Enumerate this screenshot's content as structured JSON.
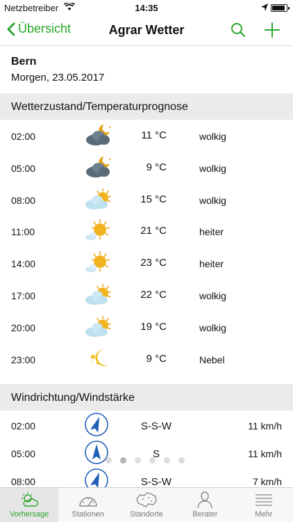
{
  "status": {
    "carrier": "Netzbetreiber",
    "time": "14:35",
    "battery": 0.9
  },
  "nav": {
    "back_label": "Übersicht",
    "title": "Agrar Wetter"
  },
  "location": {
    "city": "Bern",
    "date": "Morgen, 23.05.2017"
  },
  "sections": {
    "weather": "Wetterzustand/Temperaturprognose",
    "wind": "Windrichtung/Windstärke"
  },
  "weather_rows": [
    {
      "time": "02:00",
      "temp": "11 °C",
      "desc": "wolkig",
      "icon": "moon-cloud-icon"
    },
    {
      "time": "05:00",
      "temp": "9 °C",
      "desc": "wolkig",
      "icon": "moon-cloud-icon"
    },
    {
      "time": "08:00",
      "temp": "15 °C",
      "desc": "wolkig",
      "icon": "sun-cloud-icon"
    },
    {
      "time": "11:00",
      "temp": "21 °C",
      "desc": "heiter",
      "icon": "sun-small-cloud-icon"
    },
    {
      "time": "14:00",
      "temp": "23 °C",
      "desc": "heiter",
      "icon": "sun-small-cloud-icon"
    },
    {
      "time": "17:00",
      "temp": "22 °C",
      "desc": "wolkig",
      "icon": "sun-cloud-icon"
    },
    {
      "time": "20:00",
      "temp": "19 °C",
      "desc": "wolkig",
      "icon": "sun-cloud-icon"
    },
    {
      "time": "23:00",
      "temp": "9 °C",
      "desc": "Nebel",
      "icon": "moon-stars-icon"
    }
  ],
  "wind_rows": [
    {
      "time": "02:00",
      "dir": "S-S-W",
      "speed": "11 km/h"
    },
    {
      "time": "05:00",
      "dir": "S",
      "speed": "11 km/h"
    },
    {
      "time": "08:00",
      "dir": "S-S-W",
      "speed": "7 km/h"
    }
  ],
  "pager": {
    "count": 6,
    "active": 1
  },
  "tabs": [
    {
      "label": "Vorhersage",
      "icon": "forecast-icon",
      "active": true
    },
    {
      "label": "Stationen",
      "icon": "stations-icon",
      "active": false
    },
    {
      "label": "Standorte",
      "icon": "map-switzerland-icon",
      "active": false
    },
    {
      "label": "Berater",
      "icon": "person-icon",
      "active": false
    },
    {
      "label": "Mehr",
      "icon": "menu-icon",
      "active": false
    }
  ],
  "colors": {
    "accent": "#2aa52a",
    "section_bg": "#ebebeb",
    "arrow_blue": "#1f5fb8",
    "sun": "#e8a317"
  }
}
